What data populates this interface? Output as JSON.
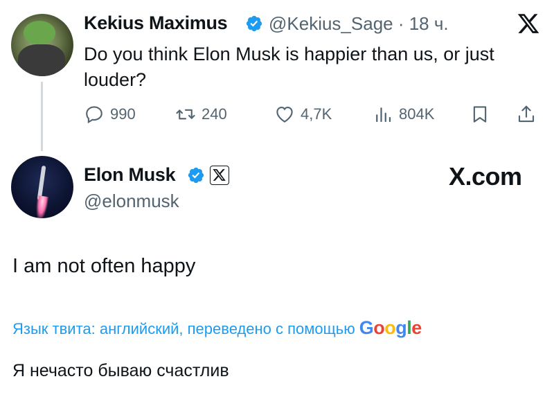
{
  "original_tweet": {
    "author_name": "Kekius Maximus",
    "handle_time": "@Kekius_Sage · 18 ч.",
    "text": "Do you think Elon Musk is happier than us, or just louder?",
    "actions": {
      "replies": "990",
      "retweets": "240",
      "likes": "4,7K",
      "views": "804K"
    }
  },
  "reply_tweet": {
    "author_name": "Elon Musk",
    "handle": "@elonmusk",
    "watermark": "X.com",
    "text": "I am not often happy",
    "translation_notice": "Язык твита: английский, переведено с помощью",
    "translation_brand": [
      "G",
      "o",
      "o",
      "g",
      "l",
      "e"
    ],
    "translated_text": "Я нечасто бываю счастлив"
  },
  "colors": {
    "accent": "#1d9bf0",
    "secondary_text": "#536471",
    "primary_text": "#0f1419"
  },
  "icons": [
    "verified-badge-icon",
    "x-logo-icon",
    "reply-icon",
    "retweet-icon",
    "like-icon",
    "views-icon",
    "bookmark-icon",
    "share-icon",
    "x-affiliate-badge-icon"
  ]
}
